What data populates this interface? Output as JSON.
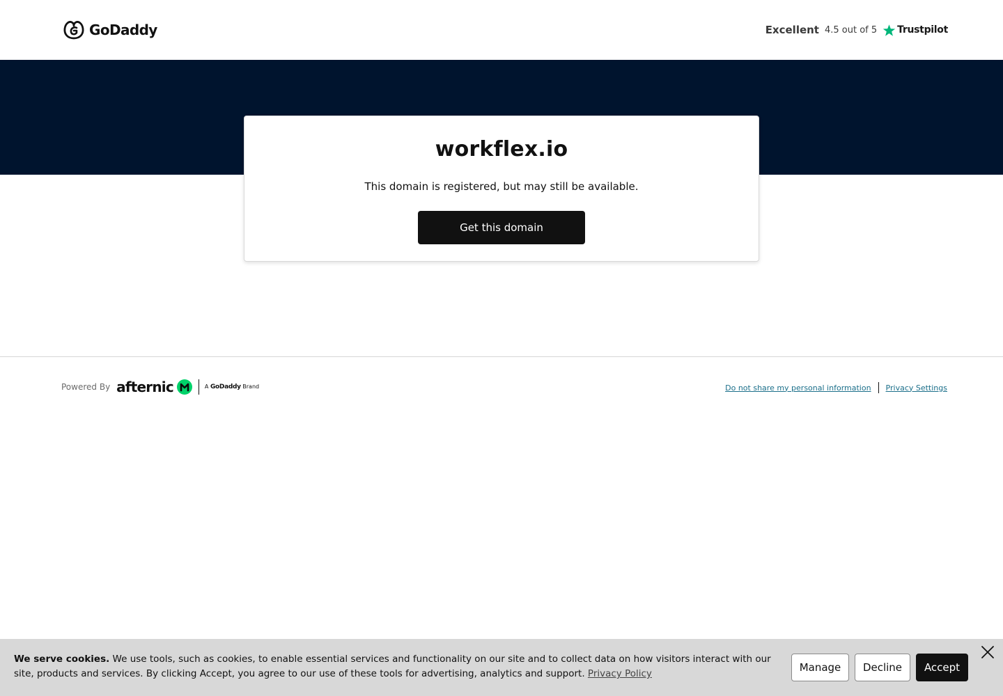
{
  "header": {
    "logo_text": "GoDaddy",
    "logo_icon": "godaddy-logo-icon",
    "trustpilot": {
      "rating_word": "Excellent",
      "score_text": "4.5 out of 5",
      "brand": "Trustpilot",
      "star_color": "#00b67a",
      "icon": "star-icon"
    }
  },
  "hero": {
    "background_color": "#00142e"
  },
  "card": {
    "domain": "workflex.io",
    "message": "This domain is registered, but may still be available.",
    "cta_label": "Get this domain"
  },
  "footer": {
    "powered_by_label": "Powered By",
    "afternic_brand": "afternic",
    "afternic_icon": "afternic-logo-icon",
    "afternic_accent": "#00d26a",
    "brand_tag_prefix": "A",
    "brand_tag_name": "GoDaddy",
    "brand_tag_suffix": "Brand",
    "links": {
      "do_not_share": "Do not share my personal information",
      "privacy_settings": "Privacy Settings"
    }
  },
  "cookie_banner": {
    "heading": "We serve cookies.",
    "body": "We use tools, such as cookies, to enable essential services and functionality on our site and to collect data on how visitors interact with our site, products and services. By clicking Accept, you agree to our use of these tools for advertising, analytics and support.",
    "policy_link": "Privacy Policy",
    "buttons": {
      "manage": "Manage",
      "decline": "Decline",
      "accept": "Accept"
    },
    "close_icon": "close-icon"
  }
}
